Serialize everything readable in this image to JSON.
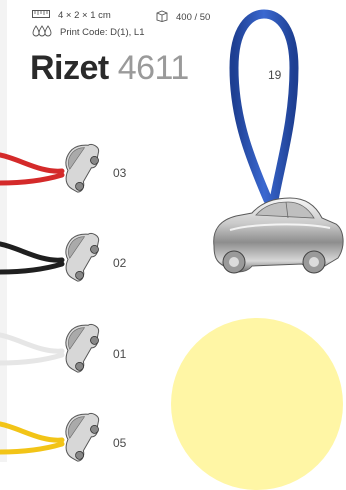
{
  "product": {
    "name": "Rizet",
    "code": "4611",
    "dimensions": "4 × 2 × 1 cm",
    "packaging": "400 / 50",
    "print_code": "Print Code: D(1), L1",
    "main_color_code": "19",
    "colors": {
      "main_loop": "#2c56b8",
      "circle": "#fff6a5"
    }
  },
  "icons": {
    "dimensions": "ruler-icon",
    "packaging": "box-icon",
    "print": "drops-icon"
  },
  "variants": [
    {
      "code": "03",
      "cord_color": "#d42a2a"
    },
    {
      "code": "02",
      "cord_color": "#1f1f1f"
    },
    {
      "code": "01",
      "cord_color": "#e6e6e6"
    },
    {
      "code": "05",
      "cord_color": "#f2c417"
    }
  ]
}
